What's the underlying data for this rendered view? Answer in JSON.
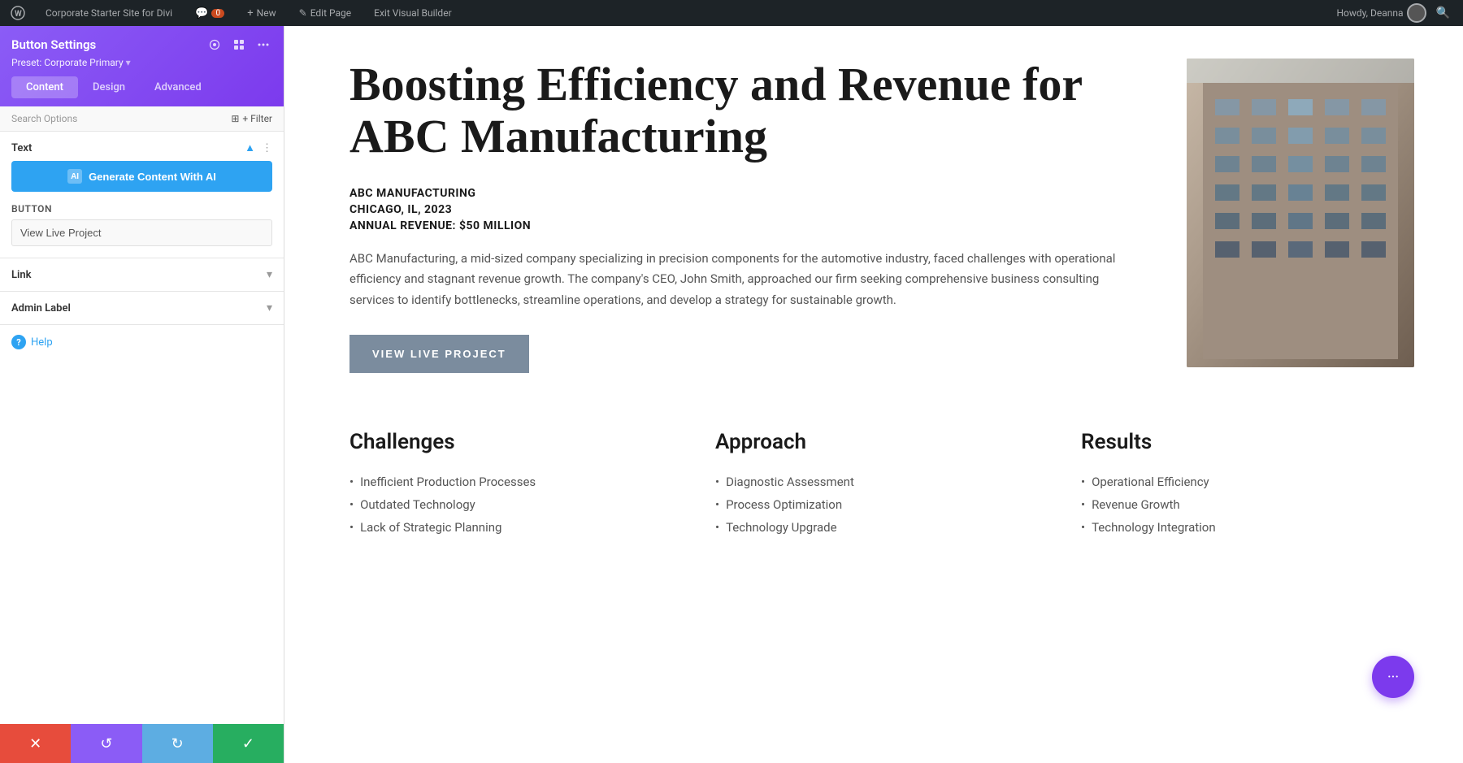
{
  "admin_bar": {
    "site_name": "Corporate Starter Site for Divi",
    "comments_label": "0",
    "new_label": "New",
    "edit_page_label": "Edit Page",
    "exit_builder_label": "Exit Visual Builder",
    "howdy_label": "Howdy, Deanna"
  },
  "settings_panel": {
    "title": "Button Settings",
    "preset_label": "Preset: Corporate Primary",
    "icons": {
      "copy": "⊞",
      "grid": "⊟",
      "more": "⋯"
    },
    "tabs": [
      {
        "label": "Content",
        "active": true
      },
      {
        "label": "Design",
        "active": false
      },
      {
        "label": "Advanced",
        "active": false
      }
    ],
    "search_placeholder": "Search Options",
    "filter_label": "+ Filter",
    "text_section": {
      "title": "Text",
      "generate_btn_label": "Generate Content With AI",
      "ai_icon_label": "AI"
    },
    "button_section": {
      "title": "Button",
      "input_value": "View Live Project"
    },
    "link_section": {
      "title": "Link"
    },
    "admin_label_section": {
      "title": "Admin Label"
    },
    "help_label": "Help"
  },
  "bottom_toolbar": {
    "cancel_icon": "✕",
    "undo_icon": "↺",
    "redo_icon": "↻",
    "save_icon": "✓"
  },
  "page": {
    "hero": {
      "title": "Boosting Efficiency and Revenue for ABC Manufacturing",
      "company": "ABC MANUFACTURING",
      "location": "CHICAGO, IL, 2023",
      "revenue": "ANNUAL REVENUE: $50 MILLION",
      "description": "ABC Manufacturing, a mid-sized company specializing in precision components for the automotive industry, faced challenges with operational efficiency and stagnant revenue growth. The company's CEO, John Smith, approached our firm seeking comprehensive business consulting services to identify bottlenecks, streamline operations, and develop a strategy for sustainable growth.",
      "button_label": "VIEW LIVE PROJECT"
    },
    "columns": [
      {
        "title": "Challenges",
        "items": [
          "Inefficient Production Processes",
          "Outdated Technology",
          "Lack of Strategic Planning"
        ]
      },
      {
        "title": "Approach",
        "items": [
          "Diagnostic Assessment",
          "Process Optimization",
          "Technology Upgrade"
        ]
      },
      {
        "title": "Results",
        "items": [
          "Operational Efficiency",
          "Revenue Growth",
          "Technology Integration"
        ]
      }
    ]
  },
  "floating_bubble": {
    "icon": "···"
  }
}
